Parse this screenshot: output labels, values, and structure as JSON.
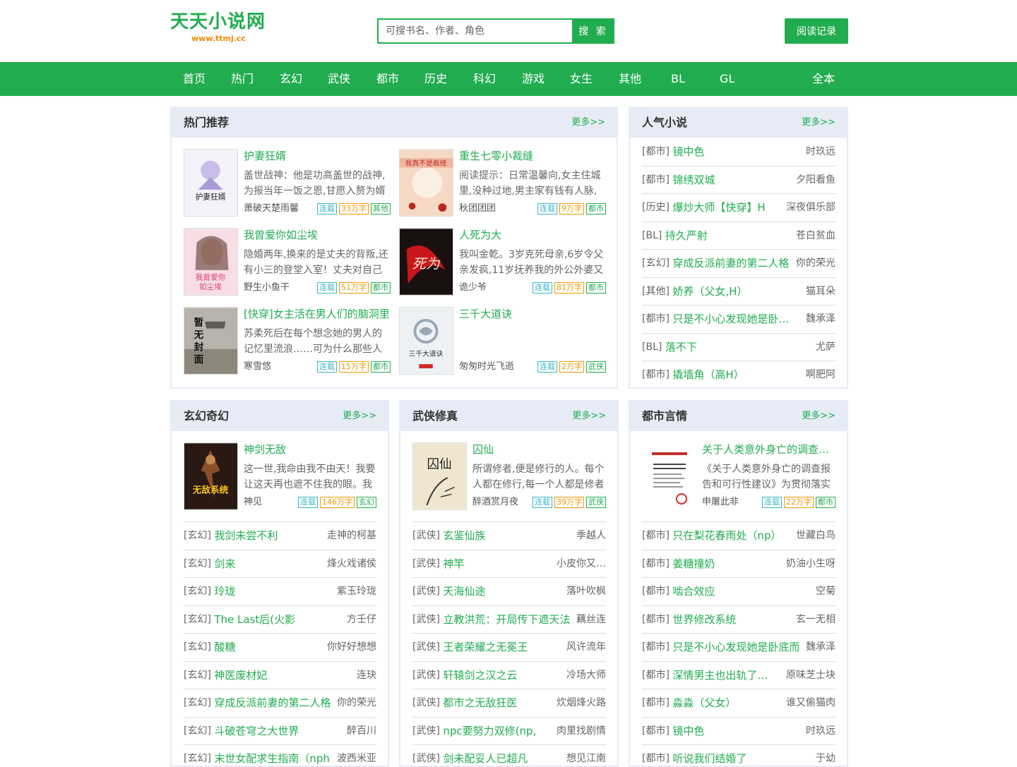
{
  "site": {
    "name": "天天小说网",
    "domain": "www.ttmj.cc"
  },
  "search": {
    "placeholder": "可搜书名、作者、角色",
    "button": "搜 索"
  },
  "history_button": "阅读记录",
  "nav": [
    "首页",
    "热门",
    "玄幻",
    "武侠",
    "都市",
    "历史",
    "科幻",
    "游戏",
    "女生",
    "其他",
    "BL",
    "GL",
    "全本"
  ],
  "hot": {
    "title": "热门推荐",
    "more": "更多>>",
    "books": [
      {
        "title": "护妻狂婿",
        "desc": "盖世战神：他是功高盖世的战神,为报当年一饭之恩,甘愿入赘为婿",
        "author": "萧破天楚雨馨",
        "status": "连载",
        "words": "33万字",
        "cat": "其他"
      },
      {
        "title": "重生七零小裁缝",
        "desc": "阅读提示：日常温馨向,女主住城里,没种过地,男主家有钱有人脉,非",
        "author": "秋团团团",
        "status": "连载",
        "words": "9万字",
        "cat": "都市"
      },
      {
        "title": "我曾爱你如尘埃",
        "desc": "隐婚两年,换来的是丈夫的背叛,还有小三的登堂入室！丈夫对自己",
        "author": "野生小鱼干",
        "status": "连载",
        "words": "51万字",
        "cat": "都市"
      },
      {
        "title": "人死为大",
        "desc": "我叫金乾。3岁克死母亲,6岁令父亲发疯,11岁抚养我的外公外婆又",
        "author": "诡少爷",
        "status": "连载",
        "words": "81万字",
        "cat": "都市"
      },
      {
        "title": "[快穿]女主活在男人们的脑洞里",
        "desc": "苏柔死后在每个想念她的男人的记忆里流浪……可为什么那些人",
        "author": "寒雪悠",
        "status": "连载",
        "words": "15万字",
        "cat": "都市"
      },
      {
        "title": "三千大道诀",
        "desc": "",
        "author": "匆匆时光飞逝",
        "status": "连载",
        "words": "2万字",
        "cat": "武侠"
      }
    ]
  },
  "popular": {
    "title": "人气小说",
    "more": "更多>>",
    "rows": [
      {
        "cat": "[都市]",
        "name": "镜中色",
        "author": "时玖远"
      },
      {
        "cat": "[都市]",
        "name": "锦绣双城",
        "author": "夕阳看鱼"
      },
      {
        "cat": "[历史]",
        "name": "爆炒大师【快穿】H",
        "author": "深夜俱乐部"
      },
      {
        "cat": "[BL]",
        "name": "持久严射",
        "author": "苍白贫血"
      },
      {
        "cat": "[玄幻]",
        "name": "穿成反派前妻的第二人格",
        "author": "你的荣光"
      },
      {
        "cat": "[其他]",
        "name": "娇养（父女,H）",
        "author": "猫耳朵"
      },
      {
        "cat": "[都市]",
        "name": "只是不小心发现她是卧底而已",
        "author": "魏承泽"
      },
      {
        "cat": "[BL]",
        "name": "落不下",
        "author": "尤萨"
      },
      {
        "cat": "[都市]",
        "name": "撬墙角（高H）",
        "author": "啊肥阿"
      }
    ]
  },
  "xuanhuan": {
    "title": "玄幻奇幻",
    "more": "更多>>",
    "book": {
      "title": "神剑无敌",
      "desc": "这一世,我命由我不由天！我要让这天再也遮不住我的眼。我",
      "author": "神见",
      "status": "连载",
      "words": "146万字",
      "cat": "玄幻"
    },
    "rows": [
      {
        "cat": "[玄幻]",
        "name": "我剑未尝不利",
        "author": "走神的柯基"
      },
      {
        "cat": "[玄幻]",
        "name": "剑来",
        "author": "烽火戏诸侯"
      },
      {
        "cat": "[玄幻]",
        "name": "玲珑",
        "author": "紫玉玲珑"
      },
      {
        "cat": "[玄幻]",
        "name": "The Last后(火影",
        "author": "方壬仔"
      },
      {
        "cat": "[玄幻]",
        "name": "酸糖",
        "author": "你好好想想"
      },
      {
        "cat": "[玄幻]",
        "name": "神医废材妃",
        "author": "连玦"
      },
      {
        "cat": "[玄幻]",
        "name": "穿成反派前妻的第二人格",
        "author": "你的荣光"
      },
      {
        "cat": "[玄幻]",
        "name": "斗破苍穹之大世界",
        "author": "醉百川"
      },
      {
        "cat": "[玄幻]",
        "name": "末世女配求生指南（nph",
        "author": "波西米亚"
      }
    ]
  },
  "wuxia": {
    "title": "武侠修真",
    "more": "更多>>",
    "book": {
      "title": "囚仙",
      "desc": "所谓修者,便是修行的人。每个人都在修行,每一个人都是修者",
      "author": "醉酒赏月夜",
      "status": "连载",
      "words": "39万字",
      "cat": "武侠"
    },
    "rows": [
      {
        "cat": "[武侠]",
        "name": "玄鉴仙族",
        "author": "季越人"
      },
      {
        "cat": "[武侠]",
        "name": "神竿",
        "author": "小皮你又吃饭了"
      },
      {
        "cat": "[武侠]",
        "name": "天海仙途",
        "author": "落叶吹枫"
      },
      {
        "cat": "[武侠]",
        "name": "立教洪荒：开局传下遮天法",
        "author": "藕丝连"
      },
      {
        "cat": "[武侠]",
        "name": "王者荣耀之无冕王",
        "author": "风许流年"
      },
      {
        "cat": "[武侠]",
        "name": "轩辕剑之汉之云",
        "author": "冷场大师"
      },
      {
        "cat": "[武侠]",
        "name": "都市之无敌狂医",
        "author": "炊烟烽火路"
      },
      {
        "cat": "[武侠]",
        "name": "npc要努力双修(np,",
        "author": "肉里找剧情"
      },
      {
        "cat": "[武侠]",
        "name": "剑未配妥人已超凡",
        "author": "想见江南"
      }
    ]
  },
  "dushi": {
    "title": "都市言情",
    "more": "更多>>",
    "book": {
      "title": "关于人类意外身亡的调查报告和可行性建议",
      "desc": "《关于人类意外身亡的调查报告和可行性建议》为贯彻落实",
      "author": "申屠此非",
      "status": "连载",
      "words": "22万字",
      "cat": "都市"
    },
    "rows": [
      {
        "cat": "[都市]",
        "name": "只在梨花春雨处（np）",
        "author": "世藏白鸟"
      },
      {
        "cat": "[都市]",
        "name": "姜糖撞奶",
        "author": "奶油小生呀"
      },
      {
        "cat": "[都市]",
        "name": "啮合效应",
        "author": "空菊"
      },
      {
        "cat": "[都市]",
        "name": "世界修改系统",
        "author": "玄一无相"
      },
      {
        "cat": "[都市]",
        "name": "只是不小心发现她是卧底而",
        "author": "魏承泽"
      },
      {
        "cat": "[都市]",
        "name": "深情男主也出轨了【快穿】",
        "author": "原味芝士块"
      },
      {
        "cat": "[都市]",
        "name": "淼淼（父女）",
        "author": "谁又偷猫肉"
      },
      {
        "cat": "[都市]",
        "name": "镜中色",
        "author": "时玖远"
      },
      {
        "cat": "[都市]",
        "name": "听说我们结婚了",
        "author": "于幼"
      }
    ]
  }
}
